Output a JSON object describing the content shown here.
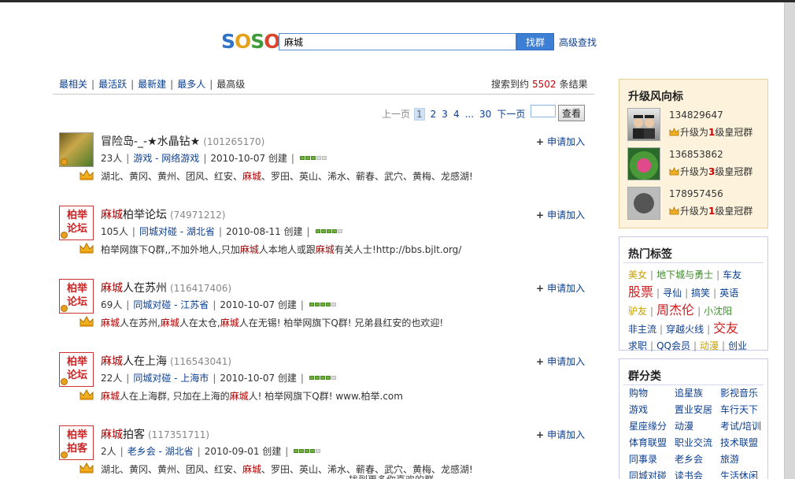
{
  "logo": {
    "letters": [
      "S",
      "O",
      "S",
      "O"
    ],
    "colors": [
      "#2f73c9",
      "#e5a21d",
      "#3e9b3a",
      "#d9452b"
    ]
  },
  "search": {
    "value": "麻城",
    "button": "找群",
    "advanced": "高级查找"
  },
  "sort_tabs": [
    "最相关",
    "最活跃",
    "最新建",
    "最多人",
    "最高级"
  ],
  "result_count": {
    "prefix": "搜索到约",
    "number": "5502",
    "suffix": "条结果"
  },
  "pager": {
    "prev": "上一页",
    "pages": [
      "1",
      "2",
      "3",
      "4"
    ],
    "ellipsis": "...",
    "last": "30",
    "next": "下一页",
    "jump_button": "查看"
  },
  "results": [
    {
      "title_pre": "冒险岛-_-★水晶钻★",
      "title_hl": "",
      "title_post": "",
      "qid": "(101265170)",
      "members": "23人",
      "category": "游戏",
      "subcategory": "- 网络游戏",
      "created": "2010-10-07 创建",
      "rating": 3,
      "desc_pre": "湖北、黄冈、黄州、团风、红安、",
      "desc_hl": "麻城",
      "desc_post": "、罗田、英山、浠水、蕲春、武穴、黄梅、龙感湖!",
      "avatar": "picture",
      "apply": "申请加入"
    },
    {
      "title_pre": "",
      "title_hl": "麻城",
      "title_post": "柏举论坛",
      "qid": "(74971212)",
      "members": "105人",
      "category": "同城对碰",
      "subcategory": "- 湖北省",
      "created": "2010-08-11 创建",
      "rating": 4,
      "desc_pre": "柏举网旗下Q群,,不加外地人,只加",
      "desc_hl": "麻城",
      "desc_mid": "人本地人或跟",
      "desc_hl2": "麻城",
      "desc_post": "有关人士!http://bbs.bjlt.org/",
      "avatar": "柏举论坛",
      "apply": "申请加入"
    },
    {
      "title_pre": "",
      "title_hl": "麻城",
      "title_post": "人在苏州",
      "qid": "(116417406)",
      "members": "69人",
      "category": "同城对碰",
      "subcategory": "- 江苏省",
      "created": "2010-10-07 创建",
      "rating": 4,
      "desc_parts": [
        "麻城",
        "人在苏州,",
        "麻城",
        "人在太仓,",
        "麻城",
        "人在无锡! 柏举网旗下Q群! 兄弟县红安的也欢迎!"
      ],
      "avatar": "柏举论坛",
      "apply": "申请加入"
    },
    {
      "title_pre": "",
      "title_hl": "麻城",
      "title_post": "人在上海",
      "qid": "(116543041)",
      "members": "22人",
      "category": "同城对碰",
      "subcategory": "- 上海市",
      "created": "2010-10-07 创建",
      "rating": 4,
      "desc_parts": [
        "麻城",
        "人在上海群, 只加在上海的",
        "麻城",
        "人! 柏举网旗下Q群! www.柏举.com"
      ],
      "avatar": "柏举论坛",
      "apply": "申请加入"
    },
    {
      "title_pre": "",
      "title_hl": "麻城",
      "title_post": "拍客",
      "qid": "(117351711)",
      "members": "2人",
      "category": "老乡会",
      "subcategory": "- 湖北省",
      "created": "2010-09-01 创建",
      "rating": 4,
      "desc_pre": "湖北、黄冈、黄州、团风、红安、",
      "desc_hl": "麻城",
      "desc_post": "、罗田、英山、浠水、蕲春、武穴、黄梅、龙感湖!",
      "avatar": "柏举拍客",
      "apply": "申请加入"
    }
  ],
  "upgrade_panel": {
    "title": "升级风向标",
    "items": [
      {
        "id": "134829647",
        "text_pre": "升级为",
        "level": "1",
        "text_post": "级皇冠群"
      },
      {
        "id": "136853862",
        "text_pre": "升级为",
        "level": "3",
        "text_post": "级皇冠群"
      },
      {
        "id": "178957456",
        "text_pre": "升级为",
        "level": "1",
        "text_post": "级皇冠群"
      }
    ]
  },
  "hot_tags": {
    "title": "热门标签",
    "rows": [
      [
        {
          "t": "美女",
          "c": "#c8a000"
        },
        {
          "t": "地下城与勇士",
          "c": "#3d8a2a"
        },
        {
          "t": "车友",
          "c": "#0b3f91"
        }
      ],
      [
        {
          "t": "股票",
          "c": "#d01c1c",
          "big": true
        },
        {
          "t": "寻仙",
          "c": "#0b3f91"
        },
        {
          "t": "搞笑",
          "c": "#0b3f91"
        },
        {
          "t": "英语",
          "c": "#0b3f91"
        }
      ],
      [
        {
          "t": "驴友",
          "c": "#c8a000"
        },
        {
          "t": "周杰伦",
          "c": "#d01c1c",
          "big": true
        },
        {
          "t": "小沈阳",
          "c": "#3d8a2a"
        }
      ],
      [
        {
          "t": "非主流",
          "c": "#0b3f91"
        },
        {
          "t": "穿越火线",
          "c": "#0b3f91"
        },
        {
          "t": "交友",
          "c": "#d01c1c",
          "big": true
        }
      ],
      [
        {
          "t": "求职",
          "c": "#0b3f91"
        },
        {
          "t": "QQ会员",
          "c": "#0b3f91"
        },
        {
          "t": "动漫",
          "c": "#c8a000"
        },
        {
          "t": "创业",
          "c": "#0b3f91"
        }
      ]
    ]
  },
  "categories": {
    "title": "群分类",
    "items": [
      "购物",
      "追星族",
      "影视音乐",
      "游戏",
      "置业安居",
      "车行天下",
      "星座缘分",
      "动漫",
      "考试/培训",
      "体育联盟",
      "职业交流",
      "技术联盟",
      "同事录",
      "老乡会",
      "旅游",
      "同城对碰",
      "读书会",
      "生活休闲"
    ]
  },
  "bottom_text": "找到更多你喜欢的群"
}
